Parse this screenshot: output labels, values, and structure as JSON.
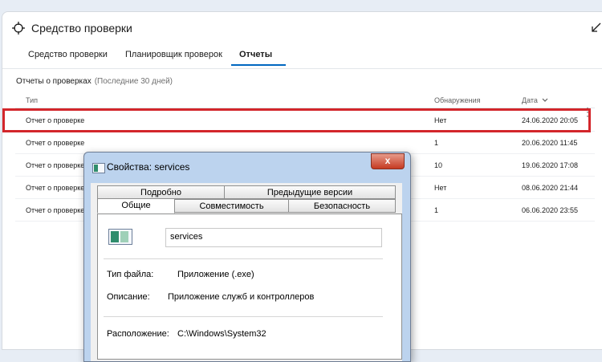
{
  "app": {
    "title": "Средство проверки",
    "tabs": [
      {
        "label": "Средство проверки"
      },
      {
        "label": "Планировщик проверок"
      },
      {
        "label": "Отчеты"
      }
    ]
  },
  "reports": {
    "title": "Отчеты о проверках",
    "subtitle": "(Последние 30 дней)",
    "columns": {
      "type": "Тип",
      "detections": "Обнаружения",
      "date": "Дата"
    },
    "rows": [
      {
        "type": "Отчет о проверке",
        "detections": "Нет",
        "date": "24.06.2020 20:05"
      },
      {
        "type": "Отчет о проверке",
        "detections": "1",
        "date": "20.06.2020 11:45"
      },
      {
        "type": "Отчет о проверке",
        "detections": "10",
        "date": "19.06.2020 17:08"
      },
      {
        "type": "Отчет о проверке",
        "detections": "Нет",
        "date": "08.06.2020 21:44"
      },
      {
        "type": "Отчет о проверке",
        "detections": "1",
        "date": "06.06.2020 23:55"
      }
    ],
    "highlight_color": "#d3262b"
  },
  "dialog": {
    "title": "Свойства: services",
    "close_label": "x",
    "tabs_top": [
      {
        "label": "Подробно"
      },
      {
        "label": "Предыдущие версии"
      }
    ],
    "tabs_bottom": [
      {
        "label": "Общие"
      },
      {
        "label": "Совместимость"
      },
      {
        "label": "Безопасность"
      }
    ],
    "file_name": "services",
    "file_type_label": "Тип файла:",
    "file_type_value": "Приложение (.exe)",
    "description_label": "Описание:",
    "description_value": "Приложение служб и контроллеров",
    "location_label": "Расположение:",
    "location_value": "C:\\Windows\\System32"
  },
  "icons": {
    "title": "scan-target-icon",
    "collapse": "collapse-arrow-icon",
    "sort": "chevron-down-icon",
    "more": "more-vertical-icon"
  },
  "colors": {
    "accent": "#0067c0",
    "dialog_frame": "#bcd3ee",
    "close": "#c53a22"
  }
}
